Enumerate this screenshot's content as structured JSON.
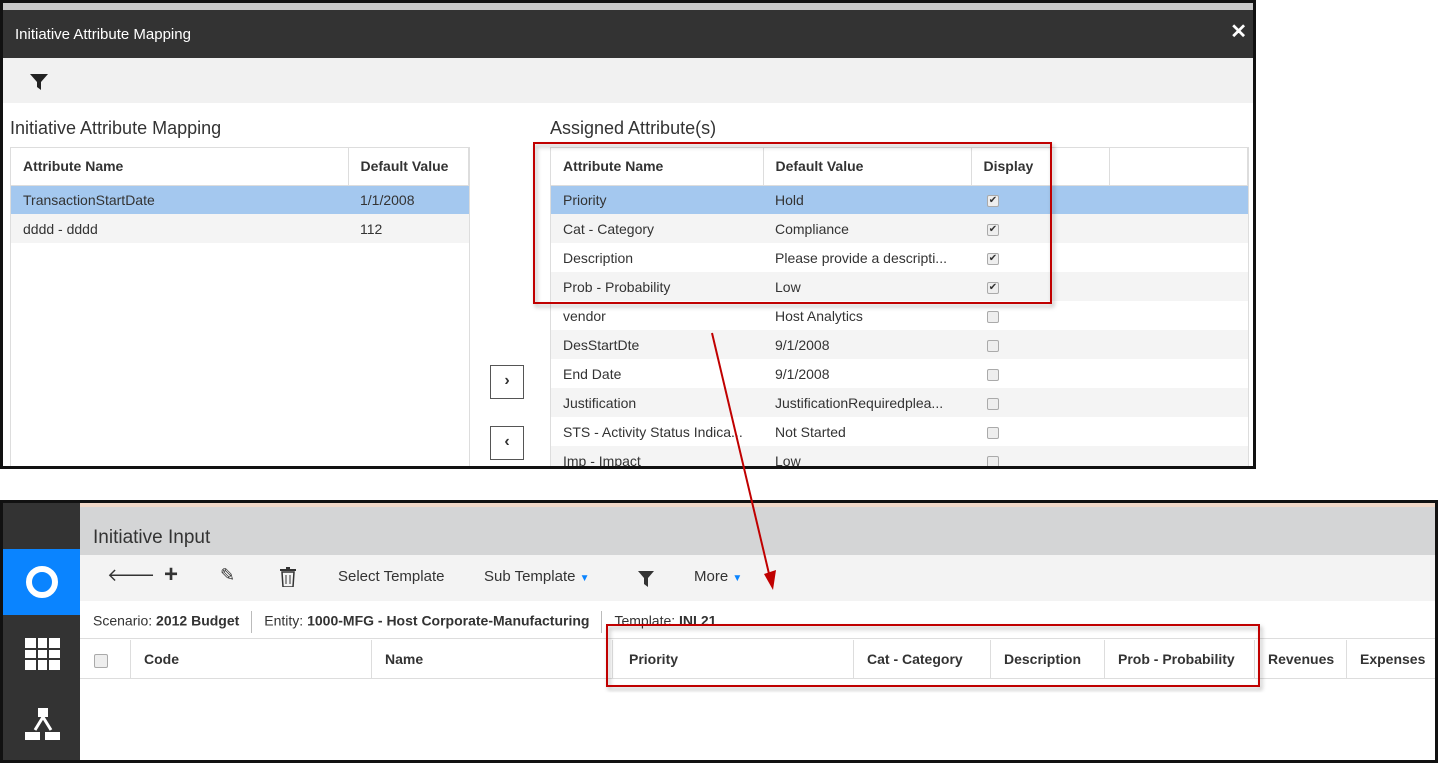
{
  "dialog": {
    "title": "Initiative Attribute Mapping",
    "close_icon": "close-icon",
    "filter_icon": "filter-icon",
    "left_title": "Initiative Attribute Mapping",
    "left_columns": [
      "Attribute Name",
      "Default Value"
    ],
    "left_rows": [
      {
        "name": "TransactionStartDate",
        "value": "1/1/2008",
        "selected": true
      },
      {
        "name": "dddd - dddd",
        "value": "112"
      }
    ],
    "right_title": "Assigned Attribute(s)",
    "right_columns": [
      "Attribute Name",
      "Default Value",
      "Display"
    ],
    "right_rows": [
      {
        "name": "Priority",
        "value": "Hold",
        "display": true,
        "selected": true
      },
      {
        "name": "Cat - Category",
        "value": "Compliance",
        "display": true
      },
      {
        "name": "Description",
        "value": "Please provide a descripti...",
        "display": true
      },
      {
        "name": "Prob - Probability",
        "value": "Low",
        "display": true
      },
      {
        "name": "vendor",
        "value": "Host Analytics",
        "display": false
      },
      {
        "name": "DesStartDte",
        "value": "9/1/2008",
        "display": false
      },
      {
        "name": "End Date",
        "value": "9/1/2008",
        "display": false
      },
      {
        "name": "Justification",
        "value": "JustificationRequiredplea...",
        "display": false
      },
      {
        "name": "STS - Activity Status Indica...",
        "value": "Not Started",
        "display": false
      },
      {
        "name": "Imp - Impact",
        "value": "Low",
        "display": false
      }
    ],
    "move_right": "›",
    "move_left": "‹"
  },
  "input": {
    "title": "Initiative Input",
    "toolbar": {
      "select_template": "Select Template",
      "sub_template": "Sub Template",
      "more": "More"
    },
    "info": {
      "scenario_label": "Scenario:",
      "scenario": "2012 Budget",
      "entity_label": "Entity:",
      "entity": "1000-MFG - Host Corporate-Manufacturing",
      "template_label": "Template:",
      "template": "INI 21"
    },
    "columns": [
      "Code",
      "Name",
      "Priority",
      "Cat - Category",
      "Description",
      "Prob - Probability",
      "Revenues",
      "Expenses"
    ]
  },
  "colors": {
    "accent": "#0a84ff",
    "selection": "#a4c8ef",
    "highlight": "#c00000"
  }
}
